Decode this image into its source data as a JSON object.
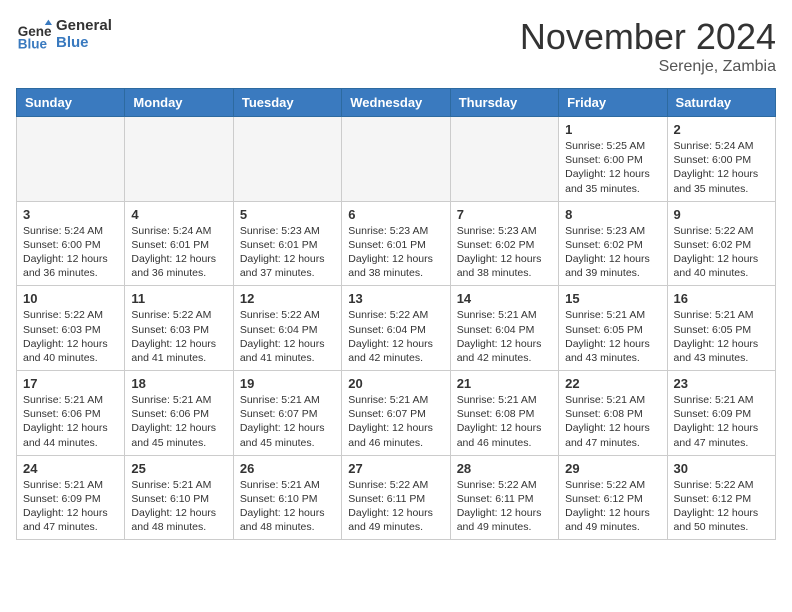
{
  "header": {
    "logo_line1": "General",
    "logo_line2": "Blue",
    "month": "November 2024",
    "location": "Serenje, Zambia"
  },
  "weekdays": [
    "Sunday",
    "Monday",
    "Tuesday",
    "Wednesday",
    "Thursday",
    "Friday",
    "Saturday"
  ],
  "weeks": [
    [
      {
        "day": "",
        "info": ""
      },
      {
        "day": "",
        "info": ""
      },
      {
        "day": "",
        "info": ""
      },
      {
        "day": "",
        "info": ""
      },
      {
        "day": "",
        "info": ""
      },
      {
        "day": "1",
        "info": "Sunrise: 5:25 AM\nSunset: 6:00 PM\nDaylight: 12 hours\nand 35 minutes."
      },
      {
        "day": "2",
        "info": "Sunrise: 5:24 AM\nSunset: 6:00 PM\nDaylight: 12 hours\nand 35 minutes."
      }
    ],
    [
      {
        "day": "3",
        "info": "Sunrise: 5:24 AM\nSunset: 6:00 PM\nDaylight: 12 hours\nand 36 minutes."
      },
      {
        "day": "4",
        "info": "Sunrise: 5:24 AM\nSunset: 6:01 PM\nDaylight: 12 hours\nand 36 minutes."
      },
      {
        "day": "5",
        "info": "Sunrise: 5:23 AM\nSunset: 6:01 PM\nDaylight: 12 hours\nand 37 minutes."
      },
      {
        "day": "6",
        "info": "Sunrise: 5:23 AM\nSunset: 6:01 PM\nDaylight: 12 hours\nand 38 minutes."
      },
      {
        "day": "7",
        "info": "Sunrise: 5:23 AM\nSunset: 6:02 PM\nDaylight: 12 hours\nand 38 minutes."
      },
      {
        "day": "8",
        "info": "Sunrise: 5:23 AM\nSunset: 6:02 PM\nDaylight: 12 hours\nand 39 minutes."
      },
      {
        "day": "9",
        "info": "Sunrise: 5:22 AM\nSunset: 6:02 PM\nDaylight: 12 hours\nand 40 minutes."
      }
    ],
    [
      {
        "day": "10",
        "info": "Sunrise: 5:22 AM\nSunset: 6:03 PM\nDaylight: 12 hours\nand 40 minutes."
      },
      {
        "day": "11",
        "info": "Sunrise: 5:22 AM\nSunset: 6:03 PM\nDaylight: 12 hours\nand 41 minutes."
      },
      {
        "day": "12",
        "info": "Sunrise: 5:22 AM\nSunset: 6:04 PM\nDaylight: 12 hours\nand 41 minutes."
      },
      {
        "day": "13",
        "info": "Sunrise: 5:22 AM\nSunset: 6:04 PM\nDaylight: 12 hours\nand 42 minutes."
      },
      {
        "day": "14",
        "info": "Sunrise: 5:21 AM\nSunset: 6:04 PM\nDaylight: 12 hours\nand 42 minutes."
      },
      {
        "day": "15",
        "info": "Sunrise: 5:21 AM\nSunset: 6:05 PM\nDaylight: 12 hours\nand 43 minutes."
      },
      {
        "day": "16",
        "info": "Sunrise: 5:21 AM\nSunset: 6:05 PM\nDaylight: 12 hours\nand 43 minutes."
      }
    ],
    [
      {
        "day": "17",
        "info": "Sunrise: 5:21 AM\nSunset: 6:06 PM\nDaylight: 12 hours\nand 44 minutes."
      },
      {
        "day": "18",
        "info": "Sunrise: 5:21 AM\nSunset: 6:06 PM\nDaylight: 12 hours\nand 45 minutes."
      },
      {
        "day": "19",
        "info": "Sunrise: 5:21 AM\nSunset: 6:07 PM\nDaylight: 12 hours\nand 45 minutes."
      },
      {
        "day": "20",
        "info": "Sunrise: 5:21 AM\nSunset: 6:07 PM\nDaylight: 12 hours\nand 46 minutes."
      },
      {
        "day": "21",
        "info": "Sunrise: 5:21 AM\nSunset: 6:08 PM\nDaylight: 12 hours\nand 46 minutes."
      },
      {
        "day": "22",
        "info": "Sunrise: 5:21 AM\nSunset: 6:08 PM\nDaylight: 12 hours\nand 47 minutes."
      },
      {
        "day": "23",
        "info": "Sunrise: 5:21 AM\nSunset: 6:09 PM\nDaylight: 12 hours\nand 47 minutes."
      }
    ],
    [
      {
        "day": "24",
        "info": "Sunrise: 5:21 AM\nSunset: 6:09 PM\nDaylight: 12 hours\nand 47 minutes."
      },
      {
        "day": "25",
        "info": "Sunrise: 5:21 AM\nSunset: 6:10 PM\nDaylight: 12 hours\nand 48 minutes."
      },
      {
        "day": "26",
        "info": "Sunrise: 5:21 AM\nSunset: 6:10 PM\nDaylight: 12 hours\nand 48 minutes."
      },
      {
        "day": "27",
        "info": "Sunrise: 5:22 AM\nSunset: 6:11 PM\nDaylight: 12 hours\nand 49 minutes."
      },
      {
        "day": "28",
        "info": "Sunrise: 5:22 AM\nSunset: 6:11 PM\nDaylight: 12 hours\nand 49 minutes."
      },
      {
        "day": "29",
        "info": "Sunrise: 5:22 AM\nSunset: 6:12 PM\nDaylight: 12 hours\nand 49 minutes."
      },
      {
        "day": "30",
        "info": "Sunrise: 5:22 AM\nSunset: 6:12 PM\nDaylight: 12 hours\nand 50 minutes."
      }
    ]
  ]
}
